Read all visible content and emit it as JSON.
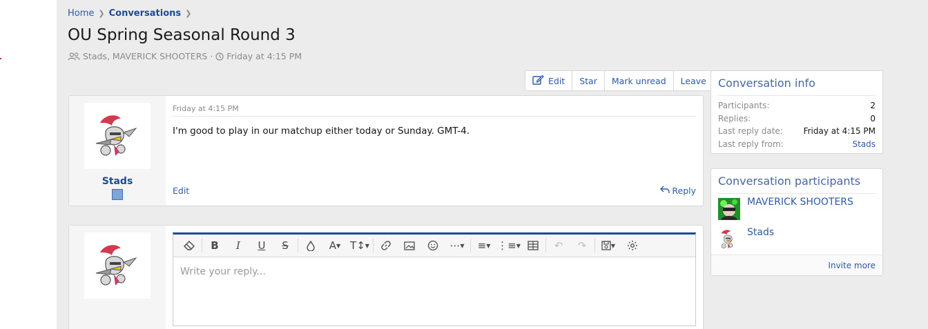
{
  "breadcrumb": {
    "home": "Home",
    "conversations": "Conversations"
  },
  "conversation": {
    "title": "OU Spring Seasonal Round 3",
    "participants_text": "Stads, MAVERICK SHOOTERS",
    "separator": "·",
    "date_text": "Friday at 4:15 PM"
  },
  "actions": {
    "edit": "Edit",
    "star": "Star",
    "mark_unread": "Mark unread",
    "leave": "Leave"
  },
  "message": {
    "date": "Friday at 4:15 PM",
    "body": "I'm good to play in our matchup either today or Sunday. GMT-4.",
    "author": "Stads",
    "edit_label": "Edit",
    "reply_label": "Reply"
  },
  "editor": {
    "placeholder": "Write your reply...",
    "toolbar_icons": [
      "eraser-icon",
      "bold-icon",
      "italic-icon",
      "underline-icon",
      "strikethrough-icon",
      "color-drop-icon",
      "font-family-icon",
      "font-size-icon",
      "link-icon",
      "image-icon",
      "smiley-icon",
      "more-icon",
      "align-icon",
      "list-icon",
      "table-icon",
      "undo-icon",
      "redo-icon",
      "drafts-icon",
      "settings-icon"
    ]
  },
  "info": {
    "title": "Conversation info",
    "participants_label": "Participants:",
    "participants_value": "2",
    "replies_label": "Replies:",
    "replies_value": "0",
    "last_reply_date_label": "Last reply date:",
    "last_reply_date_value": "Friday at 4:15 PM",
    "last_reply_from_label": "Last reply from:",
    "last_reply_from_value": "Stads"
  },
  "participants": {
    "title": "Conversation participants",
    "list": [
      {
        "name": "MAVERICK SHOOTERS"
      },
      {
        "name": "Stads"
      }
    ],
    "invite_more": "Invite more"
  },
  "colors": {
    "link": "#2c5aa8",
    "accent": "#1d4a96",
    "sidebar_title": "#4766a5",
    "page_bg": "#ececec"
  }
}
